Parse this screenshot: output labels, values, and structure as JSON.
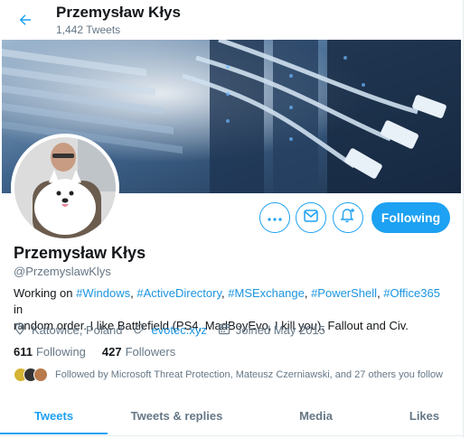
{
  "header": {
    "name": "Przemysław Kłys",
    "tweet_count": "1,442 Tweets"
  },
  "profile": {
    "name": "Przemysław Kłys",
    "handle": "@PrzemyslawKlys",
    "bio_prefix": "Working on ",
    "bio_tags": [
      "#Windows",
      "#ActiveDirectory",
      "#MSExchange",
      "#PowerShell",
      "#Office365"
    ],
    "bio_line2": "random order.   I like Battlefield (PS4, MadBoyEvo, I kill you), Fallout and Civ.",
    "bio_in": "in",
    "location": "Katowice, Poland",
    "website": "evotec.xyz",
    "joined": "Joined May 2015",
    "following_count": "611",
    "following_label": "Following",
    "followers_count": "427",
    "followers_label": "Followers",
    "followed_by": "Followed by Microsoft Threat Protection, Mateusz Czerniawski, and 27 others you follow"
  },
  "actions": {
    "follow_label": "Following",
    "more_icon": "more-icon",
    "message_icon": "message-icon",
    "notify_icon": "bell-plus-icon"
  },
  "tabs": [
    {
      "label": "Tweets",
      "active": true
    },
    {
      "label": "Tweets & replies",
      "active": false
    },
    {
      "label": "Media",
      "active": false
    },
    {
      "label": "Likes",
      "active": false
    }
  ],
  "colors": {
    "accent": "#1da1f2",
    "link": "#1b95e0",
    "muted": "#657786"
  }
}
